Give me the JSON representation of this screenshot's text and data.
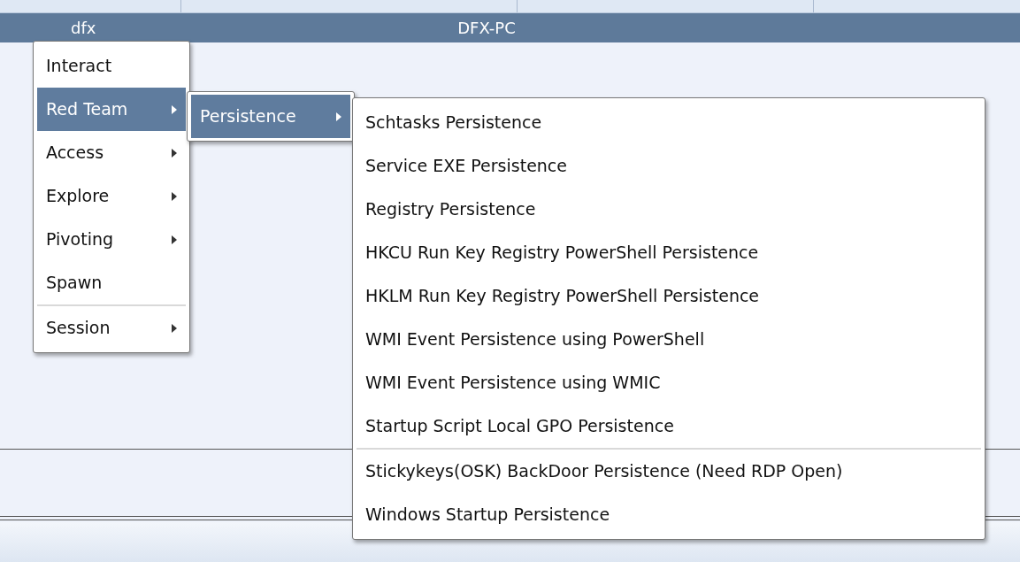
{
  "session_row": {
    "user": "dfx",
    "computer": "DFX-PC",
    "selected": true
  },
  "context_menu": [
    {
      "kind": "item",
      "label": "Interact",
      "submenu": false,
      "selected": false
    },
    {
      "kind": "item",
      "label": "Red Team",
      "submenu": true,
      "selected": true
    },
    {
      "kind": "item",
      "label": "Access",
      "submenu": true,
      "selected": false
    },
    {
      "kind": "item",
      "label": "Explore",
      "submenu": true,
      "selected": false
    },
    {
      "kind": "item",
      "label": "Pivoting",
      "submenu": true,
      "selected": false
    },
    {
      "kind": "item",
      "label": "Spawn",
      "submenu": false,
      "selected": false
    },
    {
      "kind": "separator"
    },
    {
      "kind": "item",
      "label": "Session",
      "submenu": true,
      "selected": false
    }
  ],
  "red_team_menu": [
    {
      "kind": "item",
      "label": "Persistence",
      "submenu": true,
      "selected": true
    }
  ],
  "persistence_menu": [
    {
      "kind": "item",
      "label": "Schtasks Persistence",
      "submenu": false,
      "selected": false
    },
    {
      "kind": "item",
      "label": "Service EXE Persistence",
      "submenu": false,
      "selected": false
    },
    {
      "kind": "item",
      "label": "Registry Persistence",
      "submenu": false,
      "selected": false
    },
    {
      "kind": "item",
      "label": "HKCU Run Key Registry PowerShell Persistence",
      "submenu": false,
      "selected": false
    },
    {
      "kind": "item",
      "label": "HKLM Run Key Registry PowerShell Persistence",
      "submenu": false,
      "selected": false
    },
    {
      "kind": "item",
      "label": "WMI Event Persistence using PowerShell",
      "submenu": false,
      "selected": false
    },
    {
      "kind": "item",
      "label": "WMI Event Persistence using WMIC",
      "submenu": false,
      "selected": false
    },
    {
      "kind": "item",
      "label": "Startup Script Local GPO Persistence",
      "submenu": false,
      "selected": false
    },
    {
      "kind": "separator"
    },
    {
      "kind": "item",
      "label": "Stickykeys(OSK) BackDoor Persistence (Need RDP Open)",
      "submenu": false,
      "selected": false
    },
    {
      "kind": "item",
      "label": "Windows Startup Persistence",
      "submenu": false,
      "selected": false
    }
  ]
}
